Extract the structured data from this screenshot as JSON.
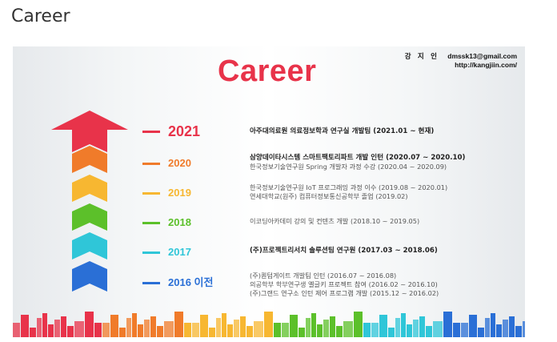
{
  "page": {
    "heading": "Career"
  },
  "slide": {
    "title": "Career",
    "contact": {
      "name": "강 지 인",
      "email": "dmssk13@gmail.com",
      "url": "http://kangjiin.com/"
    },
    "timeline": [
      {
        "year": "2021",
        "color": "#e8334a",
        "lines": [
          {
            "text": "아주대의료원 의료정보학과 연구실 개발팀 (2021.01 ~ 현재)",
            "bold": true
          }
        ]
      },
      {
        "year": "2020",
        "color": "#f07b2a",
        "lines": [
          {
            "text": "삼양데이타시스템 스마트팩토리파트 개발 인턴 (2020.07 ~ 2020.10)",
            "bold": true
          },
          {
            "text": "한국정보기술연구원 Spring 개발자 과정 수강 (2020.04 ~ 2020.09)",
            "bold": false
          }
        ]
      },
      {
        "year": "2019",
        "color": "#f7b731",
        "lines": [
          {
            "text": "한국정보기술연구원 IoT 프로그래밍 과정 이수 (2019.08 ~ 2020.01)",
            "bold": false
          },
          {
            "text": "연세대학교(원주) 컴퓨터정보통신공학부 졸업 (2019.02)",
            "bold": false,
            "bold_part": "컴퓨터정보통신공학부 졸업"
          }
        ]
      },
      {
        "year": "2018",
        "color": "#5cc02a",
        "lines": [
          {
            "text": "이코딩아카데미 강의 및 컨텐츠 개발 (2018.10 ~ 2019.05)",
            "bold": false
          }
        ]
      },
      {
        "year": "2017",
        "color": "#2fc6d8",
        "lines": [
          {
            "text": "(주)프로젝트리서치 솔루션팀 연구원 (2017.03 ~ 2018.06)",
            "bold": true
          }
        ]
      },
      {
        "year": "2016 이전",
        "color": "#2a6fd6",
        "lines": [
          {
            "text": "(주)퀀텀게이트 개발팀 인턴 (2016.07 ~ 2016.08)",
            "bold": false
          },
          {
            "text": "의공학부 학부연구생 옐글키 프로젝트 참여 (2016.02 ~ 2016.10)",
            "bold": false
          },
          {
            "text": "(주)그랜드 연구소 인턴 제어 프로그램 개발 (2015.12 ~ 2016.02)",
            "bold": false
          }
        ]
      }
    ],
    "skyline_colors": [
      "#e8334a",
      "#f07b2a",
      "#f7b731",
      "#5cc02a",
      "#2fc6d8",
      "#2a6fd6"
    ]
  }
}
